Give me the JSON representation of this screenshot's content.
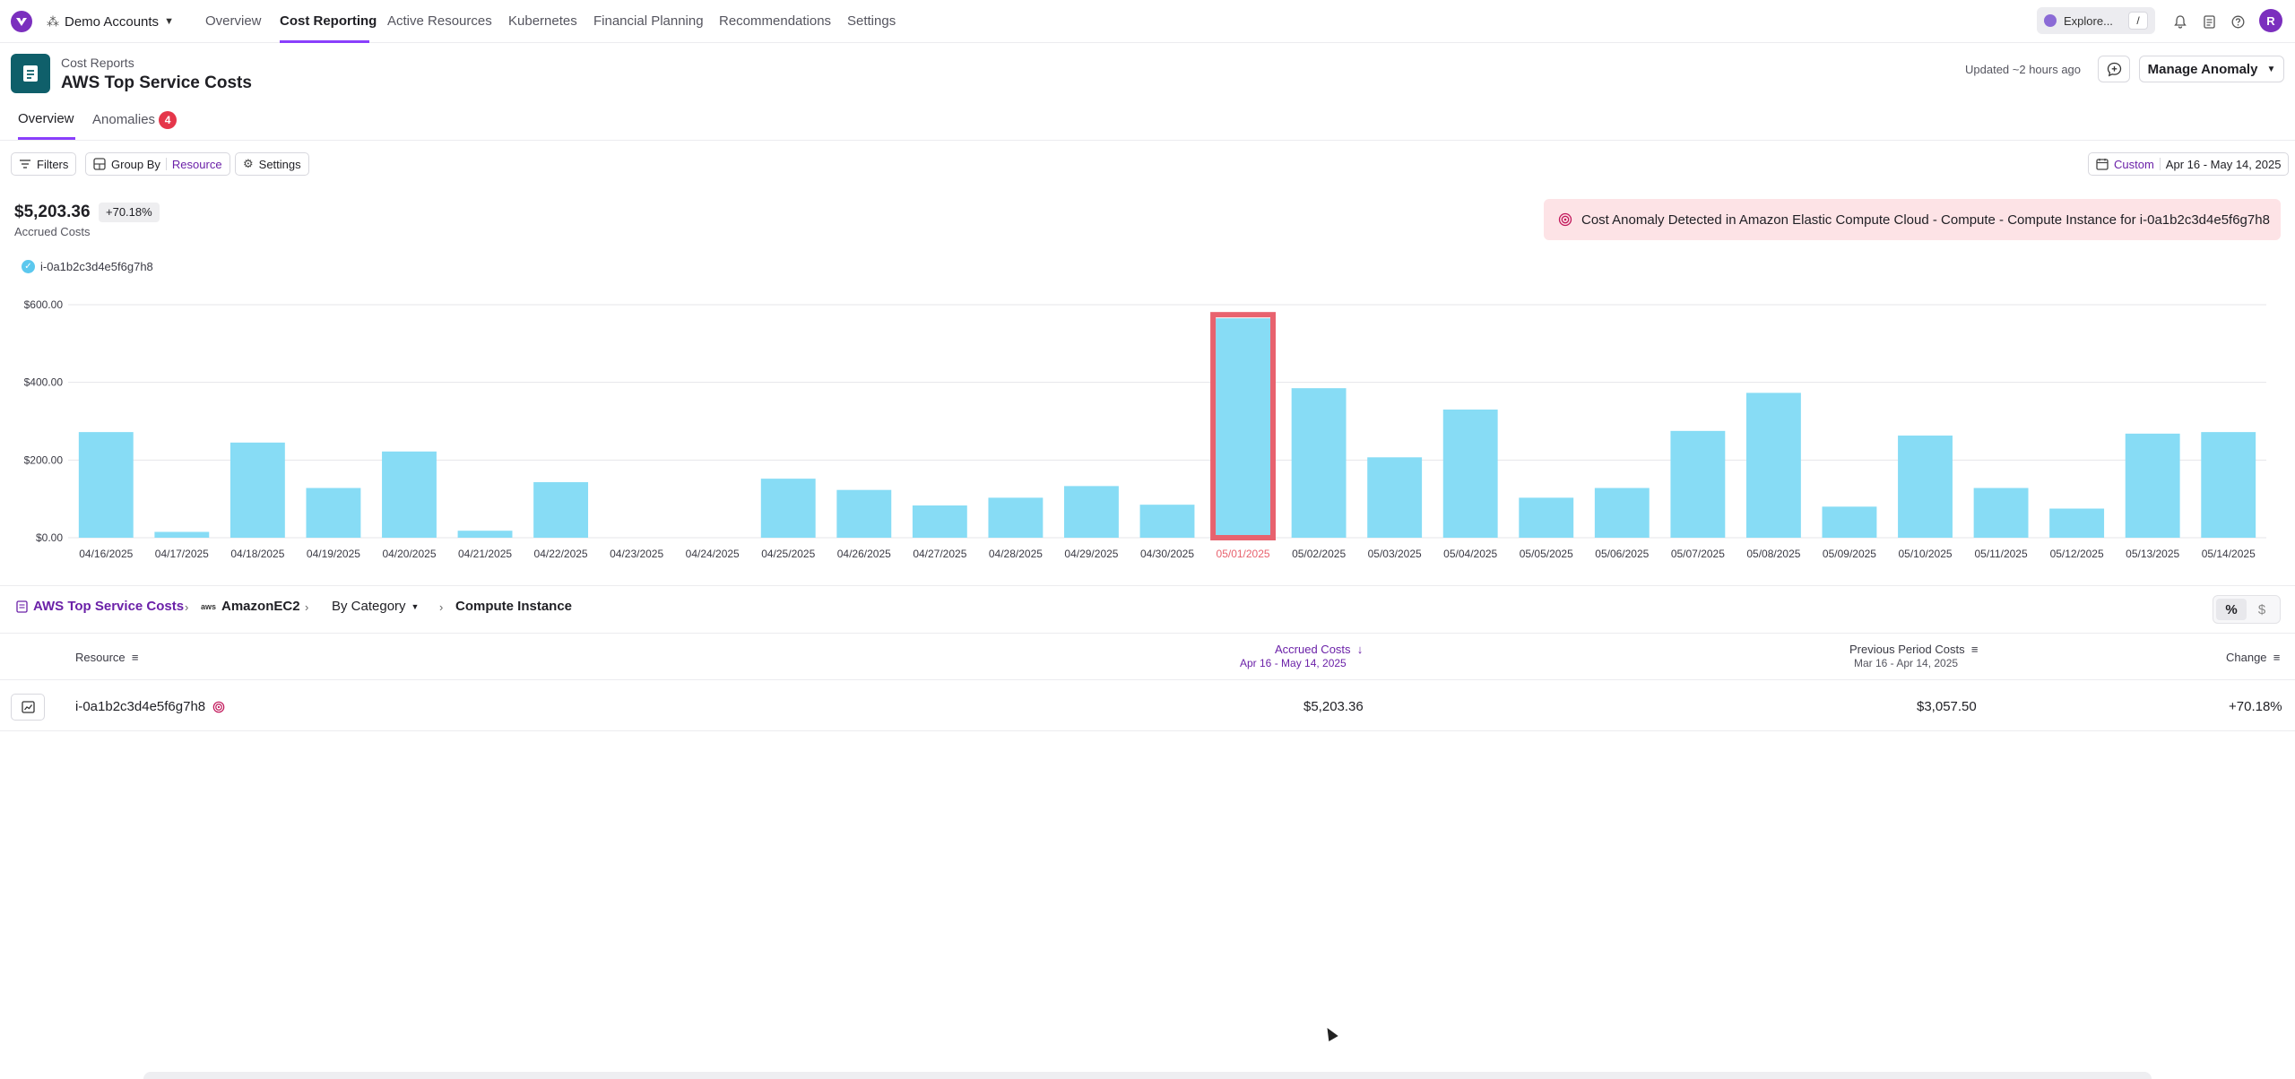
{
  "nav": {
    "account": "Demo Accounts",
    "items": [
      "Overview",
      "Cost Reporting",
      "Active Resources",
      "Kubernetes",
      "Financial Planning",
      "Recommendations",
      "Settings"
    ],
    "explore": "Explore...",
    "explore_kbd": "/",
    "avatar": "R"
  },
  "header": {
    "breadcrumb": "Cost Reports",
    "title": "AWS Top Service Costs",
    "updated": "Updated ~2 hours ago",
    "manage_button": "Manage Anomaly"
  },
  "tabs": {
    "overview": "Overview",
    "anomalies": "Anomalies",
    "anomalies_count": "4"
  },
  "toolbar": {
    "filters": "Filters",
    "group_by": "Group By",
    "group_by_value": "Resource",
    "settings": "Settings",
    "date_mode": "Custom",
    "date_range": "Apr 16 - May 14, 2025"
  },
  "summary": {
    "total": "$5,203.36",
    "change": "+70.18%",
    "label": "Accrued Costs",
    "anomaly_message": "Cost Anomaly Detected in Amazon Elastic Compute Cloud - Compute - Compute Instance for i-0a1b2c3d4e5f6g7h8",
    "legend": "i-0a1b2c3d4e5f6g7h8"
  },
  "chart_data": {
    "type": "bar",
    "categories": [
      "04/16/2025",
      "04/17/2025",
      "04/18/2025",
      "04/19/2025",
      "04/20/2025",
      "04/21/2025",
      "04/22/2025",
      "04/23/2025",
      "04/24/2025",
      "04/25/2025",
      "04/26/2025",
      "04/27/2025",
      "04/28/2025",
      "04/29/2025",
      "04/30/2025",
      "05/01/2025",
      "05/02/2025",
      "05/03/2025",
      "05/04/2025",
      "05/05/2025",
      "05/06/2025",
      "05/07/2025",
      "05/08/2025",
      "05/09/2025",
      "05/10/2025",
      "05/11/2025",
      "05/12/2025",
      "05/13/2025",
      "05/14/2025"
    ],
    "values": [
      272,
      15,
      245,
      128,
      222,
      18,
      143,
      0,
      0,
      152,
      123,
      83,
      103,
      133,
      85,
      565,
      385,
      207,
      330,
      103,
      128,
      275,
      373,
      80,
      263,
      128,
      75,
      268,
      272
    ],
    "series_name": "i-0a1b2c3d4e5f6g7h8",
    "y_ticks": [
      "$0.00",
      "$200.00",
      "$400.00",
      "$600.00"
    ],
    "ylim": [
      0,
      600
    ],
    "highlighted_category": "05/01/2025",
    "bar_color": "#87dcf5",
    "highlight_color": "#e8626e",
    "grid": true
  },
  "breadcrumb": {
    "root": "AWS Top Service Costs",
    "service_logo": "aws",
    "service": "AmazonEC2",
    "category": "By Category",
    "instance": "Compute Instance"
  },
  "toggle": {
    "percent": "%",
    "dollar": "$"
  },
  "table": {
    "columns": {
      "resource": "Resource",
      "accrued": "Accrued Costs",
      "accrued_range": "Apr 16 - May 14, 2025",
      "previous": "Previous Period Costs",
      "previous_range": "Mar 16 - Apr 14, 2025",
      "change": "Change"
    },
    "rows": [
      {
        "resource": "i-0a1b2c3d4e5f6g7h8",
        "accrued": "$5,203.36",
        "previous": "$3,057.50",
        "change": "+70.18%"
      }
    ]
  }
}
